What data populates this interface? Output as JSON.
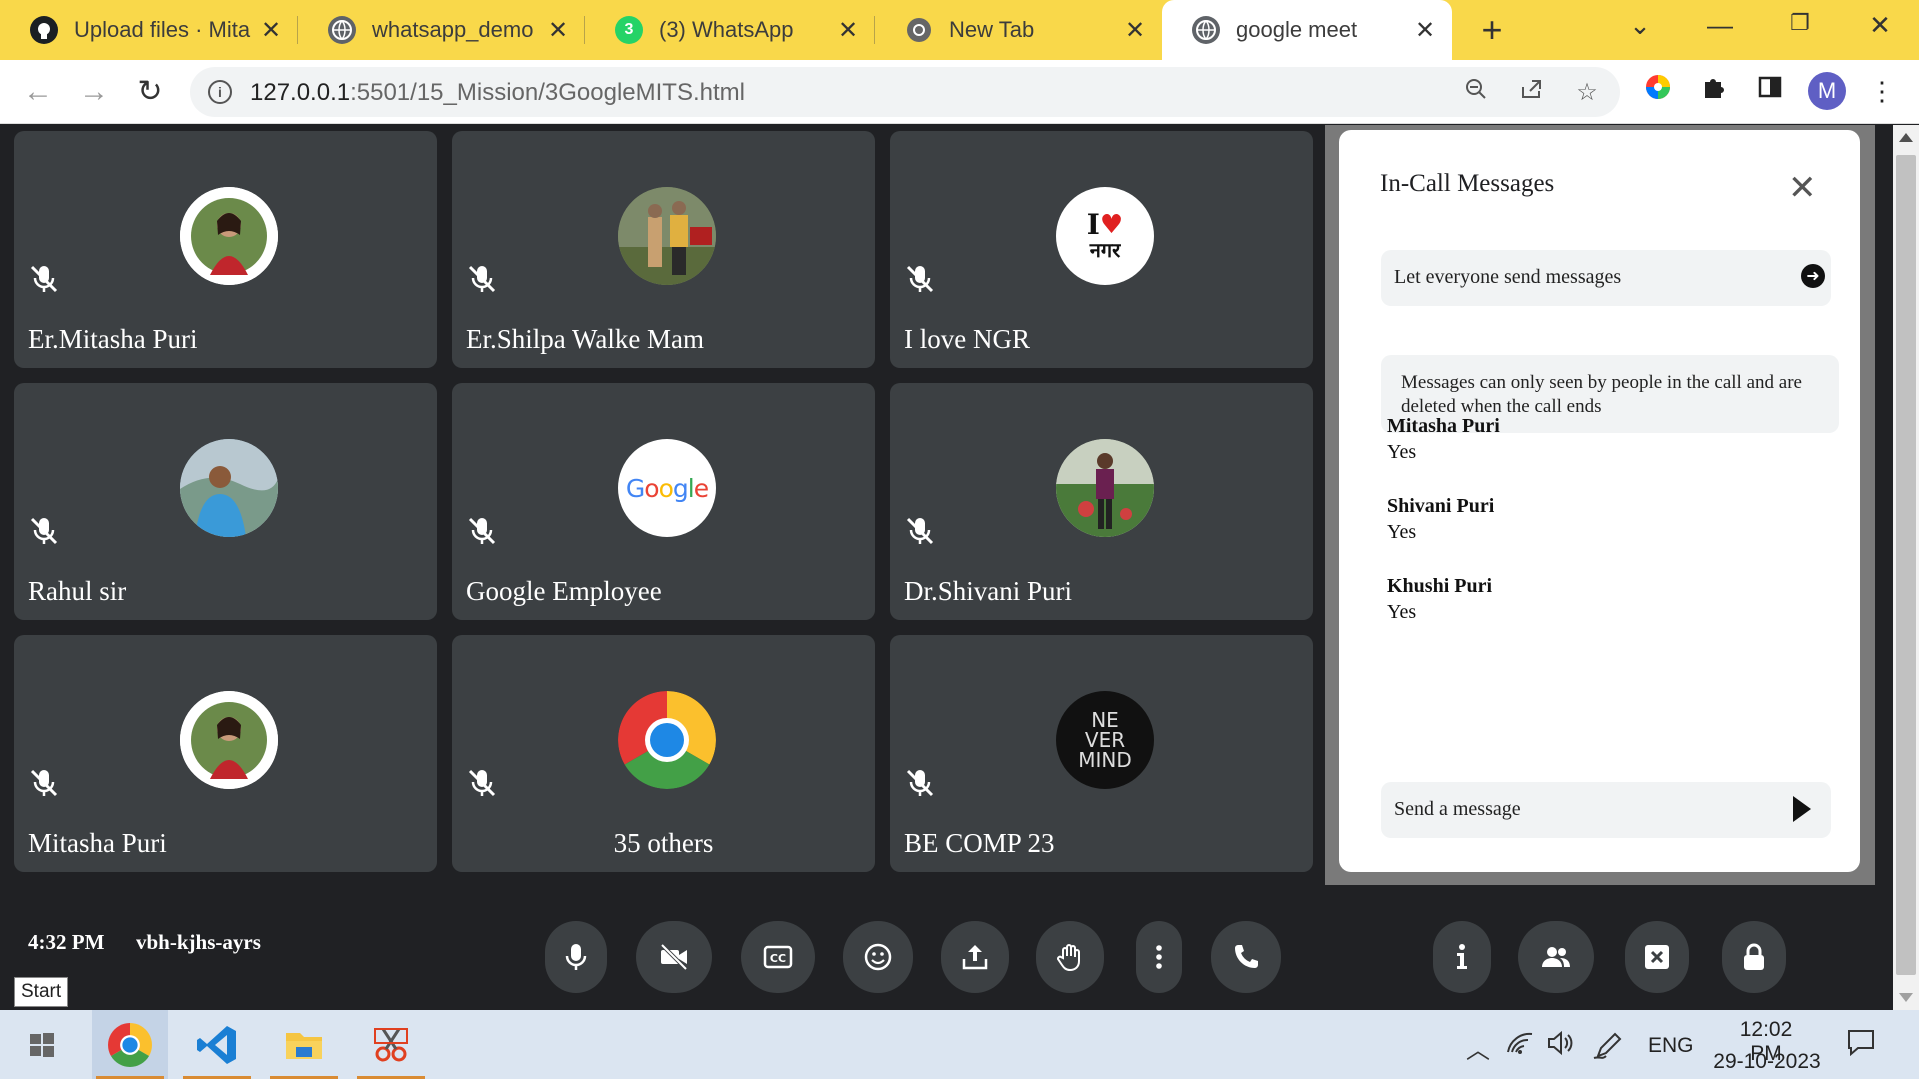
{
  "browser": {
    "tabs": [
      {
        "title": "Upload files · Mita",
        "icon": "github-icon",
        "active": false
      },
      {
        "title": "whatsapp_demo",
        "icon": "globe-icon",
        "active": false
      },
      {
        "title": "(3) WhatsApp",
        "icon": "whatsapp-icon",
        "active": false,
        "badge": "3"
      },
      {
        "title": "New Tab",
        "icon": "chrome-icon",
        "active": false
      },
      {
        "title": "google meet",
        "icon": "globe-icon",
        "active": true
      }
    ],
    "url_host": "127.0.0.1",
    "url_rest": ":5501/15_Mission/3GoogleMITS.html",
    "profile_initial": "M"
  },
  "participants": [
    {
      "name": "Er.Mitasha Puri",
      "avatar": "photo-woman-red"
    },
    {
      "name": "Er.Shilpa Walke Mam",
      "avatar": "photo-couple"
    },
    {
      "name": "I love NGR",
      "avatar": "i-love-nagar-logo"
    },
    {
      "name": "Rahul sir",
      "avatar": "photo-man-mountains"
    },
    {
      "name": "Google Employee",
      "avatar": "google-logo"
    },
    {
      "name": "Dr.Shivani Puri",
      "avatar": "photo-woman-field"
    },
    {
      "name": "Mitasha Puri",
      "avatar": "photo-woman-red"
    },
    {
      "name": "35 others",
      "avatar": "chrome-logo"
    },
    {
      "name": "BE COMP 23",
      "avatar": "never-mind-logo"
    }
  ],
  "logo_text": {
    "i_love": "I",
    "nagar": "नगर",
    "google": "Google",
    "never_mind": [
      "NE",
      "VER",
      "MIND"
    ]
  },
  "messages_panel": {
    "title": "In-Call Messages",
    "let_everyone": "Let everyone send messages",
    "notice": "Messages can only seen by people in the call and are deleted when the call ends",
    "messages": [
      {
        "sender": "Mitasha Puri",
        "text": "Yes"
      },
      {
        "sender": "Shivani Puri",
        "text": "Yes"
      },
      {
        "sender": "Khushi Puri",
        "text": "Yes"
      }
    ],
    "send_placeholder": "Send a message"
  },
  "meeting": {
    "time": "4:32 PM",
    "code": "vbh-kjhs-ayrs"
  },
  "tooltip": "Start",
  "taskbar": {
    "language": "ENG",
    "time": "12:02 PM",
    "date": "29-10-2023"
  },
  "colors": {
    "tab_strip": "#f9d84a",
    "meet_bg": "#202124",
    "tile_bg": "#3c4043",
    "accent_blue": "#4285f4"
  }
}
